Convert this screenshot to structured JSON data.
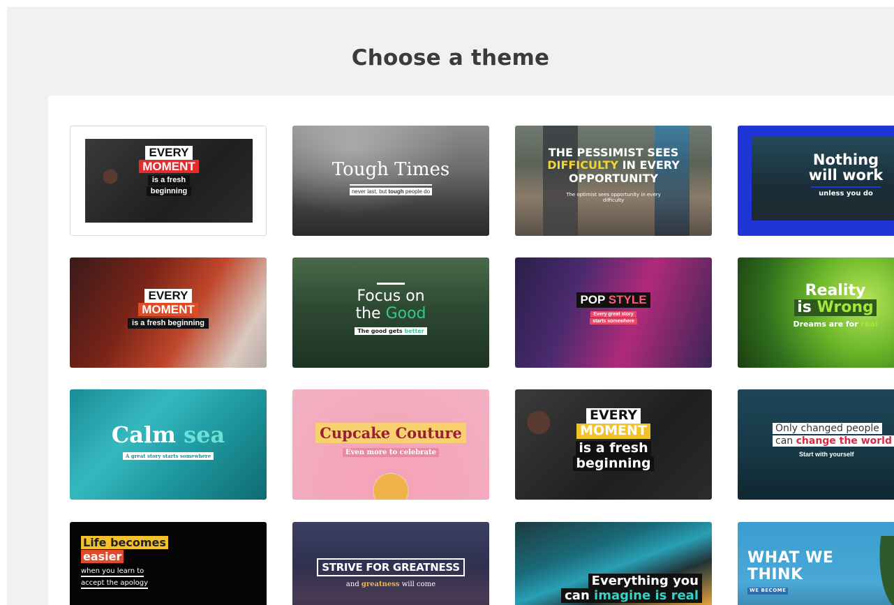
{
  "header": {
    "title": "Choose a theme"
  },
  "themes": [
    {
      "l1": "EVERY",
      "l2": "MOMENT",
      "l3": "is a fresh",
      "l4": "beginning"
    },
    {
      "title": "Tough Times",
      "sub_a": "never last, but ",
      "sub_b": "tough",
      "sub_c": " people do"
    },
    {
      "l1": "THE PESSIMIST SEES",
      "l2a": "DIFFICULTY",
      "l2b": " IN EVERY",
      "l3": "OPPORTUNITY",
      "sub": "The optimist sees opportunity in every difficulty"
    },
    {
      "l1": "Nothing",
      "l2": "will work",
      "sub": "unless you do"
    },
    {
      "l1": "EVERY",
      "l2": "MOMENT",
      "l3": "is a fresh beginning"
    },
    {
      "l1": "Focus on",
      "l2a": "the ",
      "l2b": "Good",
      "sub_a": "The good gets ",
      "sub_b": "better"
    },
    {
      "l1a": "POP ",
      "l1b": "STYLE",
      "sub1": "Every great story",
      "sub2": "starts somewhere"
    },
    {
      "l1": "Reality",
      "l2a": "is ",
      "l2b": "Wrong",
      "sub_a": "Dreams are for ",
      "sub_b": "real"
    },
    {
      "l1a": "Calm ",
      "l1b": "sea",
      "sub": "A great story starts somewhere"
    },
    {
      "title": "Cupcake Couture",
      "sub": "Even more to celebrate"
    },
    {
      "l1": "EVERY",
      "l2": "MOMENT",
      "l3": "is a fresh",
      "l4": "beginning"
    },
    {
      "l1": "Only changed people",
      "l2a": "can ",
      "l2b": "change the world",
      "sub": "Start with yourself"
    },
    {
      "l1": "Life becomes",
      "l2": "easier",
      "l3": "when you learn to",
      "l4": "accept the apology"
    },
    {
      "title": "STRIVE FOR GREATNESS",
      "sub_a": "and ",
      "sub_b": "greatness",
      "sub_c": " will come"
    },
    {
      "l1": "Everything you",
      "l2a": "can ",
      "l2b": "imagine is real"
    },
    {
      "l1": "WHAT WE",
      "l2": "THINK",
      "sub": "WE BECOME"
    }
  ],
  "colors": {
    "page_bg": "#f1f1f4",
    "panel_bg": "#ffffff",
    "title": "#3b3b3d"
  }
}
